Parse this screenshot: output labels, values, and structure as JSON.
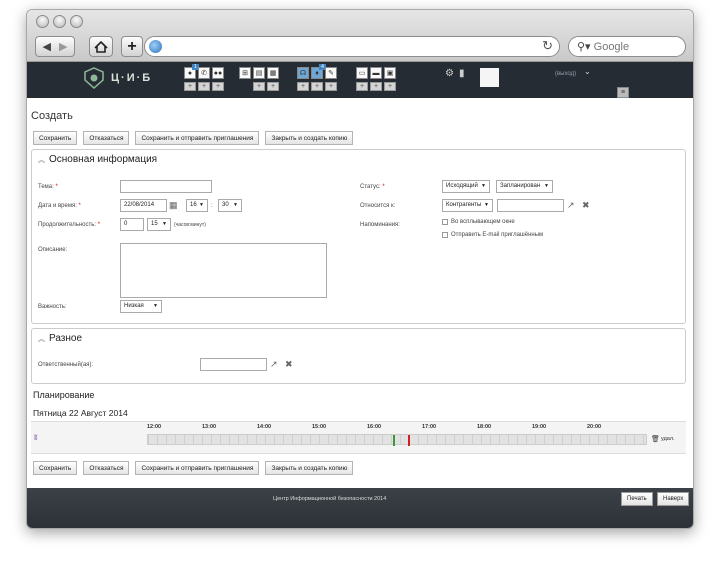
{
  "browser": {
    "search_placeholder": "Google"
  },
  "header": {
    "logo_text": "Ц·И·Б",
    "logout": "(выход)",
    "badge1": "1",
    "badge2": "4"
  },
  "title": "Создать",
  "actions": {
    "save": "Сохранить",
    "cancel": "Отказаться",
    "save_send": "Сохранить и отправить приглашения",
    "close_copy": "Закрыть и создать копию"
  },
  "main": {
    "heading": "Основная информация",
    "subject_label": "Тема:",
    "subject_value": "",
    "datetime_label": "Дата и время:",
    "date_value": "22/08/2014",
    "hour_value": "16",
    "minute_value": "30",
    "duration_label": "Продолжительность:",
    "duration_hours": "0",
    "duration_minutes": "15",
    "duration_hint": "(часов:минут)",
    "description_label": "Описание:",
    "priority_label": "Важность:",
    "priority_value": "Низкая",
    "status_label": "Статус:",
    "status_direction": "Исходящий",
    "status_state": "Запланирован",
    "related_label": "Относится к:",
    "related_type": "Контрагенты",
    "related_value": "",
    "reminders_label": "Напоминания:",
    "reminder_popup": "Во всплывающем окне",
    "reminder_email": "Отправить E-mail приглашённым"
  },
  "misc": {
    "heading": "Разное",
    "assigned_label": "Ответственный(ая):",
    "assigned_value": ""
  },
  "planning": {
    "heading": "Планирование",
    "date_heading": "Пятница 22 Август 2014",
    "hours": [
      "12:00",
      "13:00",
      "14:00",
      "15:00",
      "16:00",
      "17:00",
      "18:00",
      "19:00",
      "20:00"
    ],
    "remove_label": "удал."
  },
  "footer": {
    "copyright": "Центр Информационной безопасности 2014",
    "print": "Печать",
    "top": "Наверх"
  }
}
